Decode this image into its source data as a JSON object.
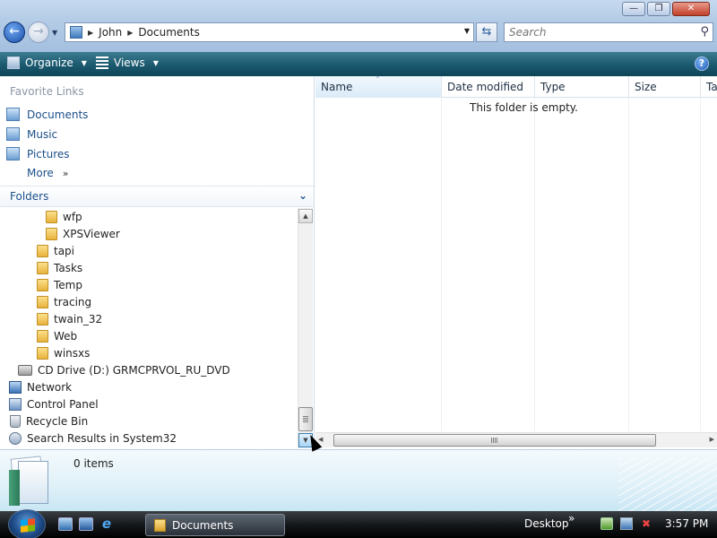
{
  "window": {
    "minimize_label": "—",
    "maximize_label": "❐",
    "close_label": "✕"
  },
  "nav": {
    "back_icon": "back-arrow-icon",
    "forward_icon": "forward-arrow-icon"
  },
  "address": {
    "crumbs": [
      "John",
      "Documents"
    ]
  },
  "search": {
    "placeholder": "Search"
  },
  "toolbar": {
    "organize_label": "Organize",
    "views_label": "Views",
    "help_label": "?"
  },
  "favorites": {
    "title": "Favorite Links",
    "items": [
      {
        "label": "Documents",
        "icon": "documents-icon"
      },
      {
        "label": "Music",
        "icon": "music-icon"
      },
      {
        "label": "Pictures",
        "icon": "pictures-icon"
      },
      {
        "label": "More",
        "icon": "more-chevron-icon"
      }
    ]
  },
  "folders": {
    "title": "Folders",
    "tree": [
      {
        "label": "wfp",
        "icon": "folder-icon"
      },
      {
        "label": "XPSViewer",
        "icon": "folder-icon"
      },
      {
        "label": "tapi",
        "icon": "folder-icon"
      },
      {
        "label": "Tasks",
        "icon": "folder-icon"
      },
      {
        "label": "Temp",
        "icon": "folder-icon"
      },
      {
        "label": "tracing",
        "icon": "folder-icon"
      },
      {
        "label": "twain_32",
        "icon": "folder-icon"
      },
      {
        "label": "Web",
        "icon": "folder-icon"
      },
      {
        "label": "winsxs",
        "icon": "folder-icon"
      },
      {
        "label": "CD Drive (D:) GRMCPRVOL_RU_DVD",
        "icon": "cd-drive-icon"
      },
      {
        "label": "Network",
        "icon": "network-icon"
      },
      {
        "label": "Control Panel",
        "icon": "control-panel-icon"
      },
      {
        "label": "Recycle Bin",
        "icon": "recycle-bin-icon"
      },
      {
        "label": "Search Results in System32",
        "icon": "search-results-icon"
      }
    ]
  },
  "file_list": {
    "columns": [
      "Name",
      "Date modified",
      "Type",
      "Size",
      "Ta"
    ],
    "empty_message": "This folder is empty."
  },
  "details": {
    "item_count": "0 items"
  },
  "taskbar": {
    "active_window": "Documents",
    "toolbar_label": "Desktop",
    "toolbar_chevron": "»",
    "clock": "3:57 PM"
  }
}
